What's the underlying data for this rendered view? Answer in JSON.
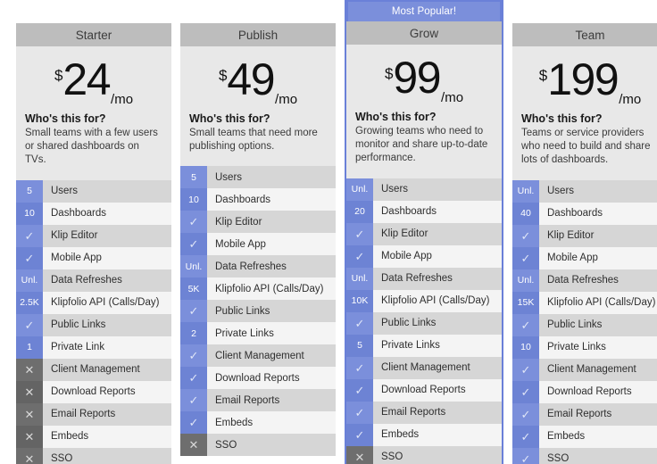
{
  "currency_symbol": "$",
  "period_label": "/mo",
  "who_title": "Who's this for?",
  "popular_label": "Most Popular!",
  "check_glyph": "✓",
  "cross_glyph": "✕",
  "feature_names": [
    "Users",
    "Dashboards",
    "Klip Editor",
    "Mobile App",
    "Data Refreshes",
    "Klipfolio API (Calls/Day)",
    "Public Links",
    "Private Link",
    "Client Management",
    "Download Reports",
    "Email Reports",
    "Embeds",
    "SSO"
  ],
  "plans": [
    {
      "name": "Starter",
      "price": "24",
      "featured": false,
      "description": "Small teams with a few users or shared dashboards on TVs.",
      "features": [
        {
          "label": "Users",
          "value": "5",
          "type": "value"
        },
        {
          "label": "Dashboards",
          "value": "10",
          "type": "value"
        },
        {
          "label": "Klip Editor",
          "value": "✓",
          "type": "yes"
        },
        {
          "label": "Mobile App",
          "value": "✓",
          "type": "yes"
        },
        {
          "label": "Data Refreshes",
          "value": "Unl.",
          "type": "value"
        },
        {
          "label": "Klipfolio API (Calls/Day)",
          "value": "2.5K",
          "type": "value"
        },
        {
          "label": "Public Links",
          "value": "✓",
          "type": "yes"
        },
        {
          "label": "Private Link",
          "value": "1",
          "type": "value"
        },
        {
          "label": "Client Management",
          "value": "✕",
          "type": "no"
        },
        {
          "label": "Download Reports",
          "value": "✕",
          "type": "no"
        },
        {
          "label": "Email Reports",
          "value": "✕",
          "type": "no"
        },
        {
          "label": "Embeds",
          "value": "✕",
          "type": "no"
        },
        {
          "label": "SSO",
          "value": "✕",
          "type": "no"
        }
      ]
    },
    {
      "name": "Publish",
      "price": "49",
      "featured": false,
      "description": "Small teams that need more publishing options.",
      "features": [
        {
          "label": "Users",
          "value": "5",
          "type": "value"
        },
        {
          "label": "Dashboards",
          "value": "10",
          "type": "value"
        },
        {
          "label": "Klip Editor",
          "value": "✓",
          "type": "yes"
        },
        {
          "label": "Mobile App",
          "value": "✓",
          "type": "yes"
        },
        {
          "label": "Data Refreshes",
          "value": "Unl.",
          "type": "value"
        },
        {
          "label": "Klipfolio API (Calls/Day)",
          "value": "5K",
          "type": "value"
        },
        {
          "label": "Public Links",
          "value": "✓",
          "type": "yes"
        },
        {
          "label": "Private Links",
          "value": "2",
          "type": "value"
        },
        {
          "label": "Client Management",
          "value": "✓",
          "type": "yes"
        },
        {
          "label": "Download Reports",
          "value": "✓",
          "type": "yes"
        },
        {
          "label": "Email Reports",
          "value": "✓",
          "type": "yes"
        },
        {
          "label": "Embeds",
          "value": "✓",
          "type": "yes"
        },
        {
          "label": "SSO",
          "value": "✕",
          "type": "no"
        }
      ]
    },
    {
      "name": "Grow",
      "price": "99",
      "featured": true,
      "description": "Growing teams who need to monitor and share up-to-date performance.",
      "features": [
        {
          "label": "Users",
          "value": "Unl.",
          "type": "value"
        },
        {
          "label": "Dashboards",
          "value": "20",
          "type": "value"
        },
        {
          "label": "Klip Editor",
          "value": "✓",
          "type": "yes"
        },
        {
          "label": "Mobile App",
          "value": "✓",
          "type": "yes"
        },
        {
          "label": "Data Refreshes",
          "value": "Unl.",
          "type": "value"
        },
        {
          "label": "Klipfolio API (Calls/Day)",
          "value": "10K",
          "type": "value"
        },
        {
          "label": "Public Links",
          "value": "✓",
          "type": "yes"
        },
        {
          "label": "Private Links",
          "value": "5",
          "type": "value"
        },
        {
          "label": "Client Management",
          "value": "✓",
          "type": "yes"
        },
        {
          "label": "Download Reports",
          "value": "✓",
          "type": "yes"
        },
        {
          "label": "Email Reports",
          "value": "✓",
          "type": "yes"
        },
        {
          "label": "Embeds",
          "value": "✓",
          "type": "yes"
        },
        {
          "label": "SSO",
          "value": "✕",
          "type": "no"
        }
      ]
    },
    {
      "name": "Team",
      "price": "199",
      "featured": false,
      "description": "Teams or service providers who need to build and share lots of dashboards.",
      "features": [
        {
          "label": "Users",
          "value": "Unl.",
          "type": "value"
        },
        {
          "label": "Dashboards",
          "value": "40",
          "type": "value"
        },
        {
          "label": "Klip Editor",
          "value": "✓",
          "type": "yes"
        },
        {
          "label": "Mobile App",
          "value": "✓",
          "type": "yes"
        },
        {
          "label": "Data Refreshes",
          "value": "Unl.",
          "type": "value"
        },
        {
          "label": "Klipfolio API (Calls/Day)",
          "value": "15K",
          "type": "value"
        },
        {
          "label": "Public Links",
          "value": "✓",
          "type": "yes"
        },
        {
          "label": "Private Links",
          "value": "10",
          "type": "value"
        },
        {
          "label": "Client Management",
          "value": "✓",
          "type": "yes"
        },
        {
          "label": "Download Reports",
          "value": "✓",
          "type": "yes"
        },
        {
          "label": "Email Reports",
          "value": "✓",
          "type": "yes"
        },
        {
          "label": "Embeds",
          "value": "✓",
          "type": "yes"
        },
        {
          "label": "SSO",
          "value": "✓",
          "type": "yes"
        }
      ]
    }
  ],
  "colors": {
    "accent_blue": "#7b8fdb",
    "accent_blue_dark": "#6d83d4",
    "featured_border": "#6a80d8",
    "header_gray": "#bdbdbd",
    "row_gray": "#d6d6d6",
    "row_light": "#f4f4f4",
    "disabled_gray": "#6e6e6e"
  }
}
